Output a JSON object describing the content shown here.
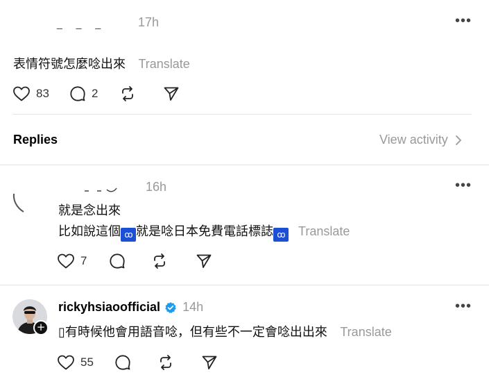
{
  "post": {
    "username_fragment": "_ _ _",
    "time": "17h",
    "text": "表情符號怎麼唸出來",
    "translate": "Translate",
    "likes": "83",
    "comments": "2"
  },
  "replies_header": {
    "title": "Replies",
    "view_activity": "View activity"
  },
  "reply1": {
    "time": "16h",
    "line1": "就是念出來",
    "line2_a": "比如說這個",
    "emoji1": "ꝏ",
    "line2_b": "就是唸日本免費電話標誌",
    "emoji2": "ꝏ",
    "translate": "Translate",
    "likes": "7"
  },
  "reply2": {
    "username": "rickyhsiaoofficial",
    "time": "14h",
    "text": "▯有時候他會用語音唸，但有些不一定會唸出出來",
    "translate": "Translate",
    "likes": "55"
  },
  "colors": {
    "divider": "#e3e3e3",
    "muted": "#999999",
    "verified": "#1d9bf0",
    "emoji_badge": "#1c4fd6"
  }
}
